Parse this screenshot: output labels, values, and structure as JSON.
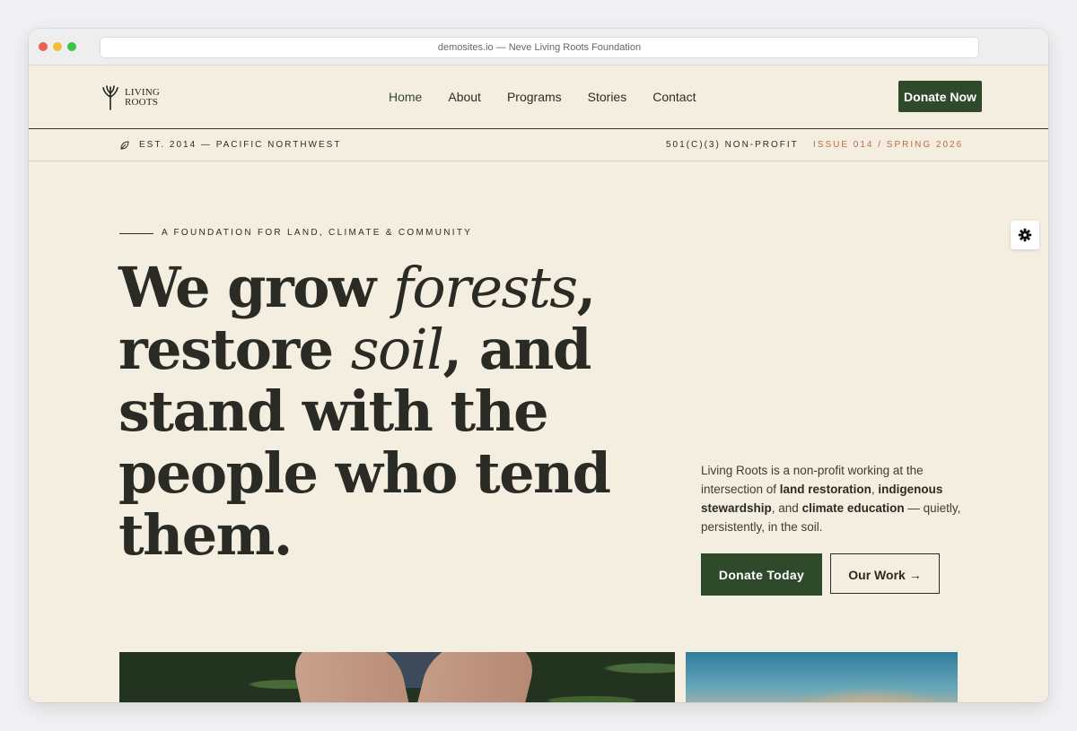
{
  "browser": {
    "url": "demosites.io — Neve Living Roots Foundation"
  },
  "header": {
    "logo_line1": "LIVING",
    "logo_line2": "ROOTS",
    "nav": [
      "Home",
      "About",
      "Programs",
      "Stories",
      "Contact"
    ],
    "active_nav": "Home",
    "cta": "Donate Now"
  },
  "strip": {
    "est": "EST. 2014 — PACIFIC NORTHWEST",
    "nonprofit": "501(C)(3) NON-PROFIT",
    "issue": "ISSUE 014 / SPRING 2026"
  },
  "hero": {
    "eyebrow": "A FOUNDATION FOR LAND, CLIMATE & COMMUNITY",
    "headline": {
      "l1a": "We grow ",
      "l1b": "forests",
      "l1c": ",",
      "l2a": "restore ",
      "l2b": "soil",
      "l2c": ", and",
      "l3": "stand with the",
      "l4": "people who tend",
      "l5": "them."
    },
    "intro": {
      "t1": "Living Roots is a non-profit working at the intersection of ",
      "b1": "land restoration",
      "t2": ", ",
      "b2": "indigenous stewardship",
      "t3": ", and ",
      "b3": "climate education",
      "t4": " — quietly, persistently, in the soil."
    },
    "primary_cta": "Donate Today",
    "secondary_cta": "Our Work →"
  },
  "colors": {
    "background": "#f4eee0",
    "brand_green": "#2e4a2b",
    "accent_rust": "#c06a45",
    "text_dark": "#2a2b24"
  },
  "icons": {
    "logo": "tree-icon",
    "strip": "leaf-icon",
    "settings": "gear-icon"
  }
}
